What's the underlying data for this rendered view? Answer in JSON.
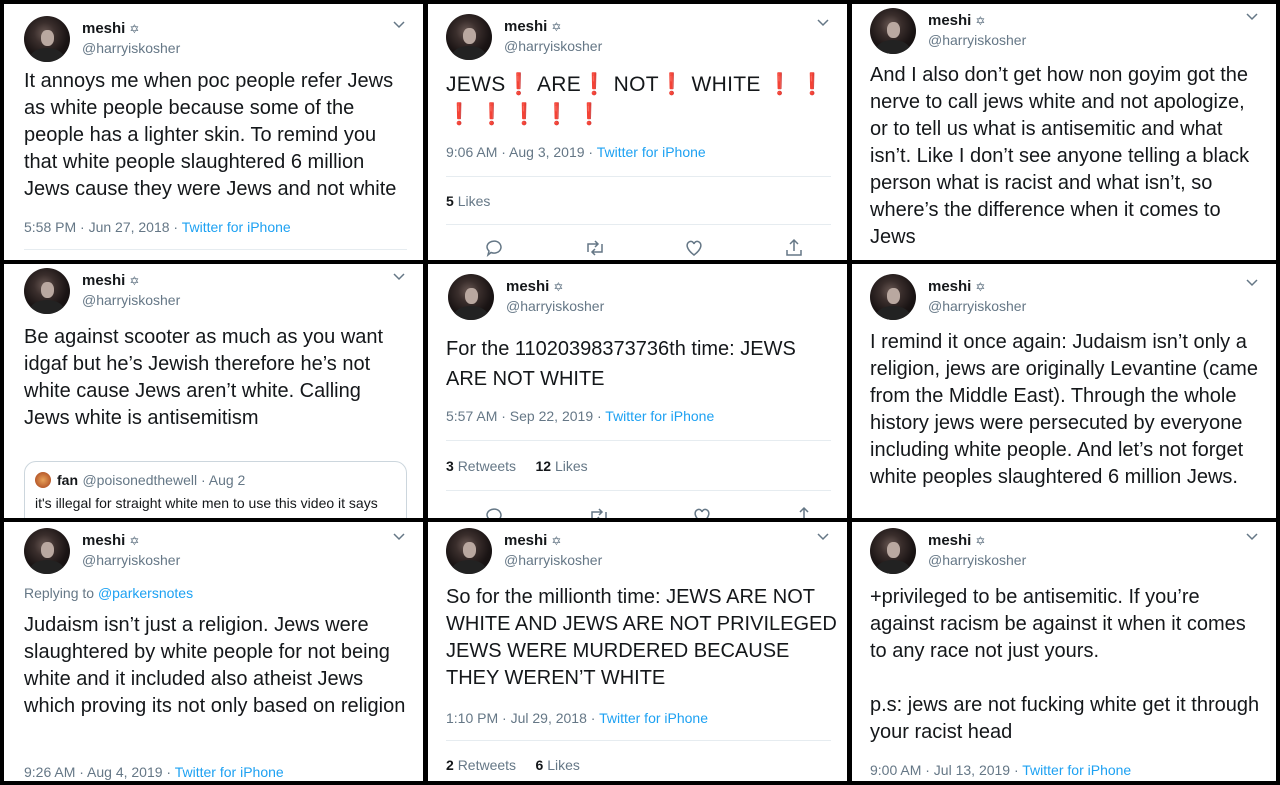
{
  "user": {
    "name": "meshi",
    "badge": "✡",
    "handle": "@harryiskosher"
  },
  "colors": {
    "link": "#1da1f2",
    "muted": "#657786",
    "text": "#14171a",
    "emoji_red": "#dd2e44"
  },
  "tweets": [
    {
      "text": "It annoys me when poc people refer Jews as white people because some of the people has a lighter skin. To remind you that white people slaughtered 6 million Jews cause they were Jews and not white",
      "time": "5:58 PM · Jun 27, 2018 · ",
      "source": "Twitter for iPhone"
    },
    {
      "text_parts": [
        "JEWS",
        "AREǃ",
        "NOT",
        "WHITE"
      ],
      "w1": "JEWS",
      "w2": "ARE",
      "w3": "NOT",
      "w4": "WHITE",
      "mark": "❗",
      "time": "9:06 AM · Aug 3, 2019 · ",
      "source": "Twitter for iPhone",
      "likes_count": "5",
      "likes_label": "Likes"
    },
    {
      "text": "And I also don’t get how non goyim got the nerve to call jews white and not apologize, or to tell us what is antisemitic and what isn’t. Like I don’t see anyone telling a black person what is racist and what isn’t, so where’s the difference when it comes to Jews"
    },
    {
      "text": "Be against scooter as much as you want idgaf but he’s Jewish therefore he’s not white cause Jews aren’t white. Calling Jews white is antisemitism",
      "quote": {
        "name": "fan",
        "handle_time": "@poisonedthewell · Aug 2",
        "text": "it's illegal for straight white men to use this video it says"
      }
    },
    {
      "text": "For the 11020398373736th time: JEWS ARE NOT WHITE",
      "time": "5:57 AM · Sep 22, 2019 · ",
      "source": "Twitter for iPhone",
      "retweets_count": "3",
      "retweets_label": "Retweets",
      "likes_count": "12",
      "likes_label": "Likes"
    },
    {
      "text": "I remind it once again: Judaism isn’t only a religion, jews are originally Levantine (came from the Middle East). Through the whole history jews were persecuted by everyone including white people. And let’s not forget white peoples slaughtered 6 million Jews."
    },
    {
      "replying_label": "Replying to ",
      "replying_to": "@parkersnotes",
      "text": "Judaism isn’t just a religion. Jews were slaughtered by white people for not being white and it included also atheist Jews which proving its not only based on religion",
      "time": "9:26 AM · Aug 4, 2019 · ",
      "source": "Twitter for iPhone"
    },
    {
      "text": "So for the millionth time: JEWS ARE NOT WHITE AND JEWS ARE NOT PRIVILEGED JEWS WERE MURDERED BECAUSE THEY WEREN’T WHITE",
      "time": "1:10 PM · Jul 29, 2018 · ",
      "source": "Twitter for iPhone",
      "retweets_count": "2",
      "retweets_label": "Retweets",
      "likes_count": "6",
      "likes_label": "Likes"
    },
    {
      "text": "+privileged to be antisemitic. If you’re against racism be against it when it comes to any race not just yours.",
      "text2": "p.s: jews are not fucking white get it through your racist head",
      "time": "9:00 AM · Jul 13, 2019 · ",
      "source": "Twitter for iPhone"
    }
  ]
}
